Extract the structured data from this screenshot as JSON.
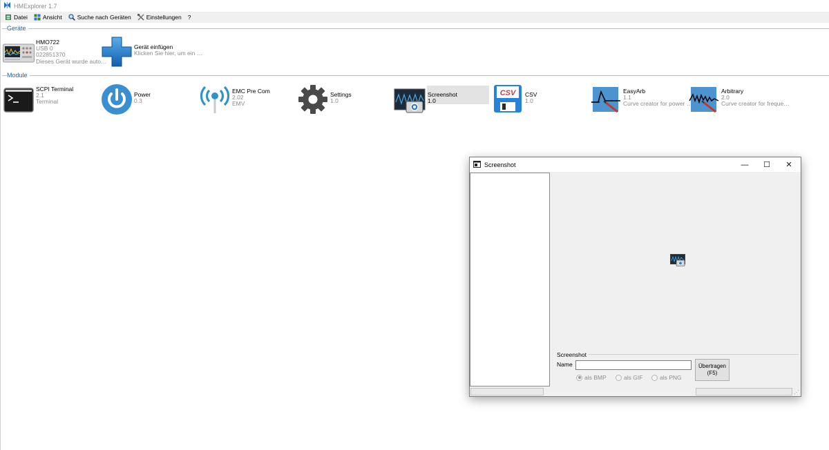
{
  "app": {
    "title": "HMExplorer 1.7"
  },
  "menu": [
    {
      "label": "Datei",
      "icon": "datei-icon"
    },
    {
      "label": "Ansicht",
      "icon": "ansicht-icon"
    },
    {
      "label": "Suche nach Geräten",
      "icon": "search-icon"
    },
    {
      "label": "Einstellungen",
      "icon": "tools-icon"
    },
    {
      "label": "?"
    }
  ],
  "devices": {
    "label": "Geräte",
    "items": [
      {
        "name": "HMO722",
        "lines": [
          "USB 0",
          "022851370",
          "Dieses Gerät wurde auto…"
        ],
        "icon": "oscilloscope-icon"
      },
      {
        "name": "Gerät einfügen",
        "lines": [
          "Klicken Sie hier, um ein …"
        ],
        "icon": "plus-icon"
      }
    ]
  },
  "modules": {
    "label": "Module",
    "items": [
      {
        "name": "SCPI Terminal",
        "version": "2.1",
        "desc": "Terminal",
        "icon": "terminal-icon"
      },
      {
        "name": "Power",
        "version": "0.3",
        "desc": "",
        "icon": "power-icon"
      },
      {
        "name": "EMC Pre Com",
        "version": "2.02",
        "desc": "EMV",
        "icon": "antenna-icon"
      },
      {
        "name": "Settings",
        "version": "1.0",
        "desc": "",
        "icon": "gear-icon"
      },
      {
        "name": "Screenshot",
        "version": "1.0",
        "desc": "",
        "icon": "screenshot-icon"
      },
      {
        "name": "CSV",
        "version": "1.0",
        "desc": "",
        "icon": "csv-icon"
      },
      {
        "name": "EasyArb",
        "version": "1.1",
        "desc": "Curve creator for power …",
        "icon": "easyarb-icon"
      },
      {
        "name": "Arbitrary",
        "version": "2.0",
        "desc": "Curve creator for freque…",
        "icon": "arbitrary-icon"
      }
    ]
  },
  "window": {
    "title": "Screenshot",
    "controls": {
      "minimize": "—",
      "maximize": "☐",
      "close": "✕"
    },
    "group_label": "Screenshot",
    "name_label": "Name",
    "name_value": "",
    "transfer_line1": "Übertragen",
    "transfer_line2": "(F5)",
    "formats": [
      {
        "label": "als BMP",
        "checked": true
      },
      {
        "label": "als GIF",
        "checked": false
      },
      {
        "label": "als PNG",
        "checked": false
      }
    ]
  }
}
